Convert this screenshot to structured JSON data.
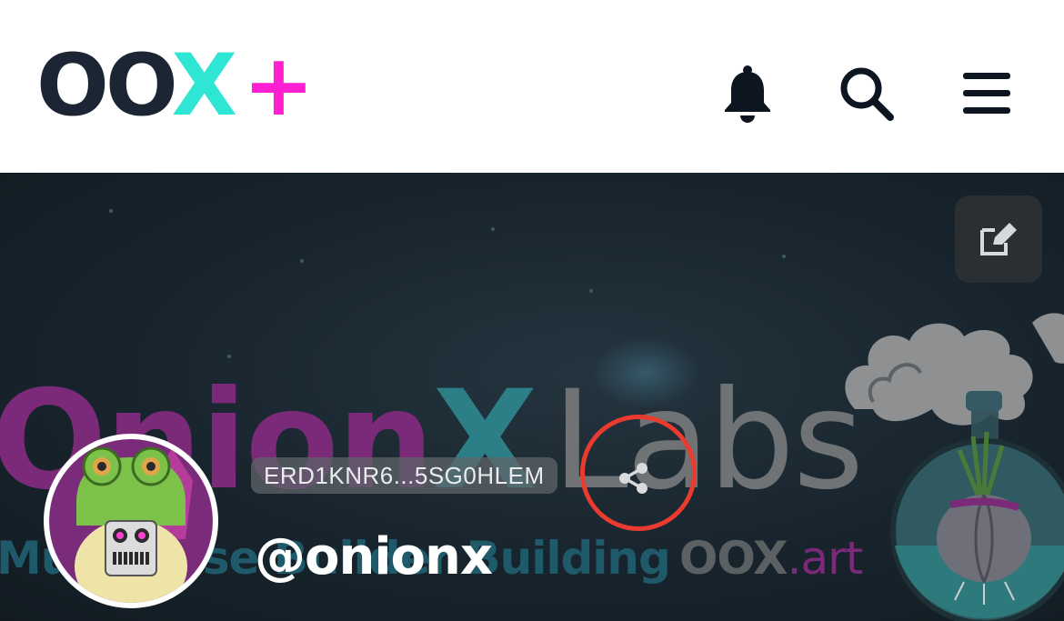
{
  "header": {
    "logo": {
      "oo": "OO",
      "x": "X",
      "plus": "+"
    },
    "icons": {
      "bell": "bell-icon",
      "search": "search-icon",
      "menu": "hamburger-menu-icon"
    }
  },
  "banner": {
    "brand_title": {
      "onion": "Onion",
      "x": "X",
      "labs": "Labs"
    },
    "brand_subtitle": {
      "text": "Multiverse Builder Building",
      "oox": "OOX",
      "art": ".art"
    },
    "edit_icon": "edit-icon",
    "share_icon": "share-icon"
  },
  "profile": {
    "wallet_address": "ERD1KNR6...5SG0HLEM",
    "handle": "@onionx"
  },
  "colors": {
    "logo_dark": "#1b2533",
    "logo_cyan": "#2fe6d5",
    "logo_magenta": "#ff1fd2",
    "highlight_ring": "#e93b30"
  }
}
